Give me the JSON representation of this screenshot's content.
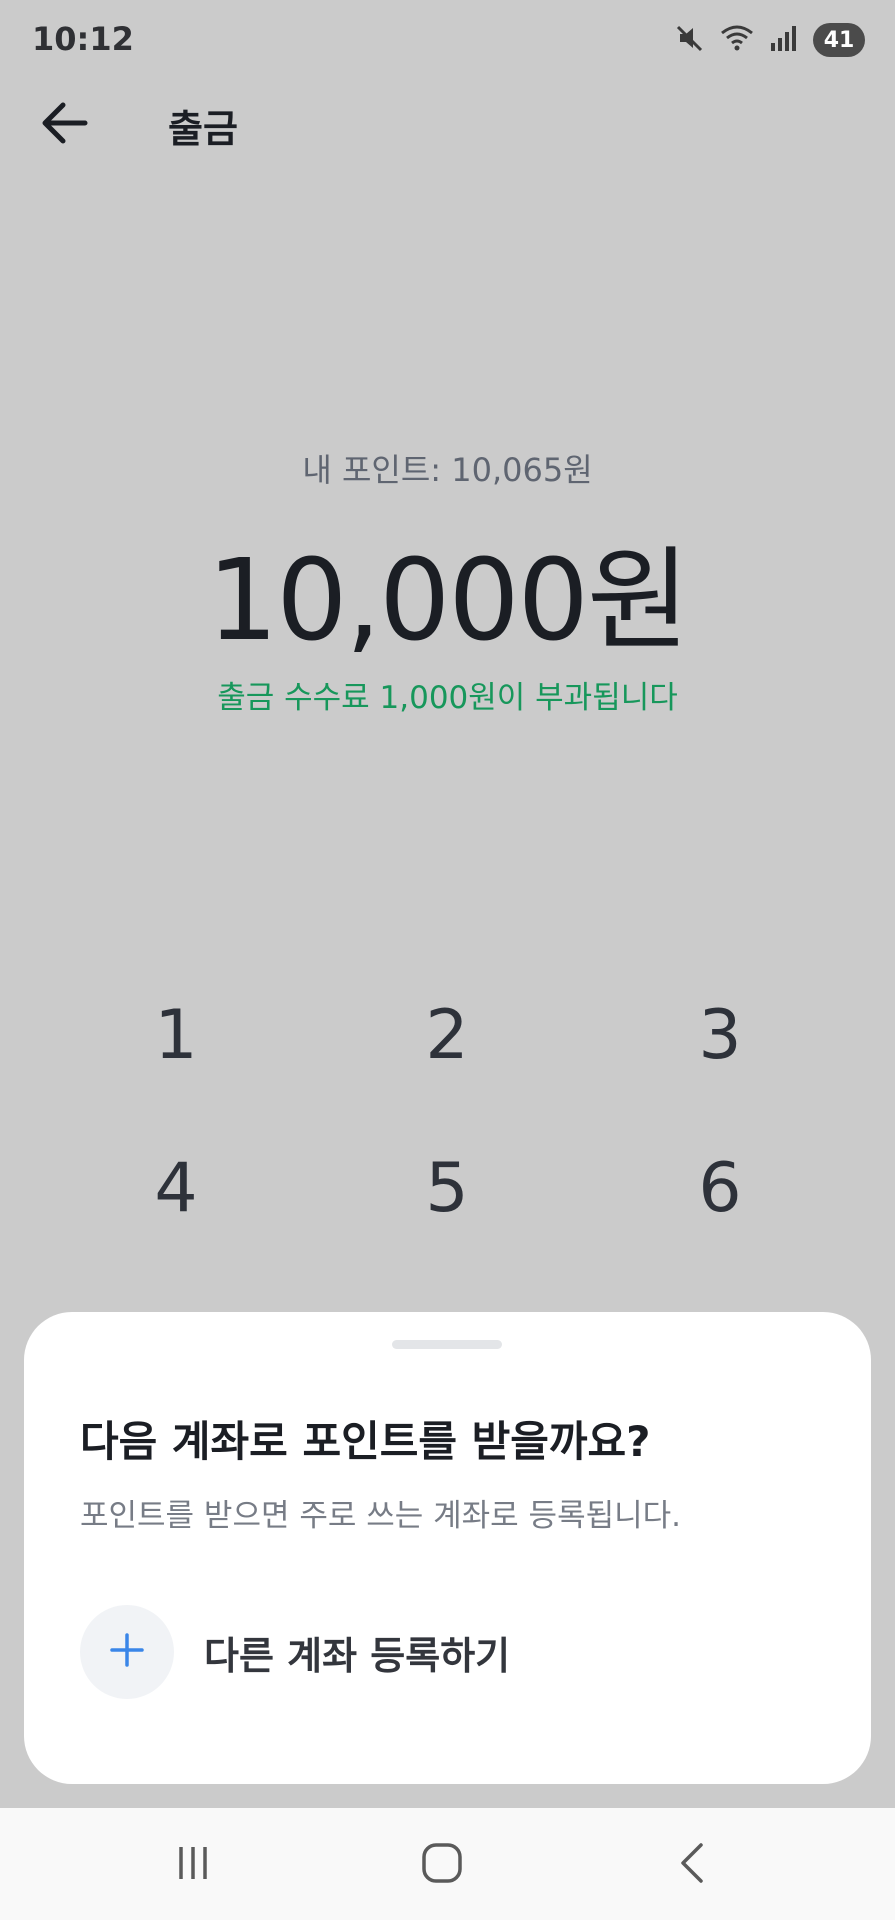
{
  "status": {
    "time": "10:12",
    "battery": "41",
    "icons": [
      "mute-icon",
      "wifi-icon",
      "signal-icon",
      "battery-icon"
    ]
  },
  "header": {
    "title": "출금",
    "back_icon": "arrow-left-icon"
  },
  "amount": {
    "balance_label": "내 포인트: 10,065원",
    "value": "10,000원",
    "fee_notice": "출금 수수료 1,000원이 부과됩니다"
  },
  "keypad": {
    "keys": [
      "1",
      "2",
      "3",
      "4",
      "5",
      "6"
    ]
  },
  "sheet": {
    "title": "다음 계좌로 포인트를 받을까요?",
    "subtitle": "포인트를 받으면 주로 쓰는 계좌로 등록됩니다.",
    "add_account_label": "다른 계좌 등록하기",
    "add_icon": "plus-icon"
  },
  "nav": {
    "icons": [
      "recent-apps-icon",
      "home-icon",
      "back-icon"
    ]
  },
  "colors": {
    "background_dim": "#cbcbcb",
    "accent_green": "#17975b",
    "accent_blue": "#3a86e8",
    "text_primary": "#1b1e24",
    "text_secondary": "#777c86"
  }
}
